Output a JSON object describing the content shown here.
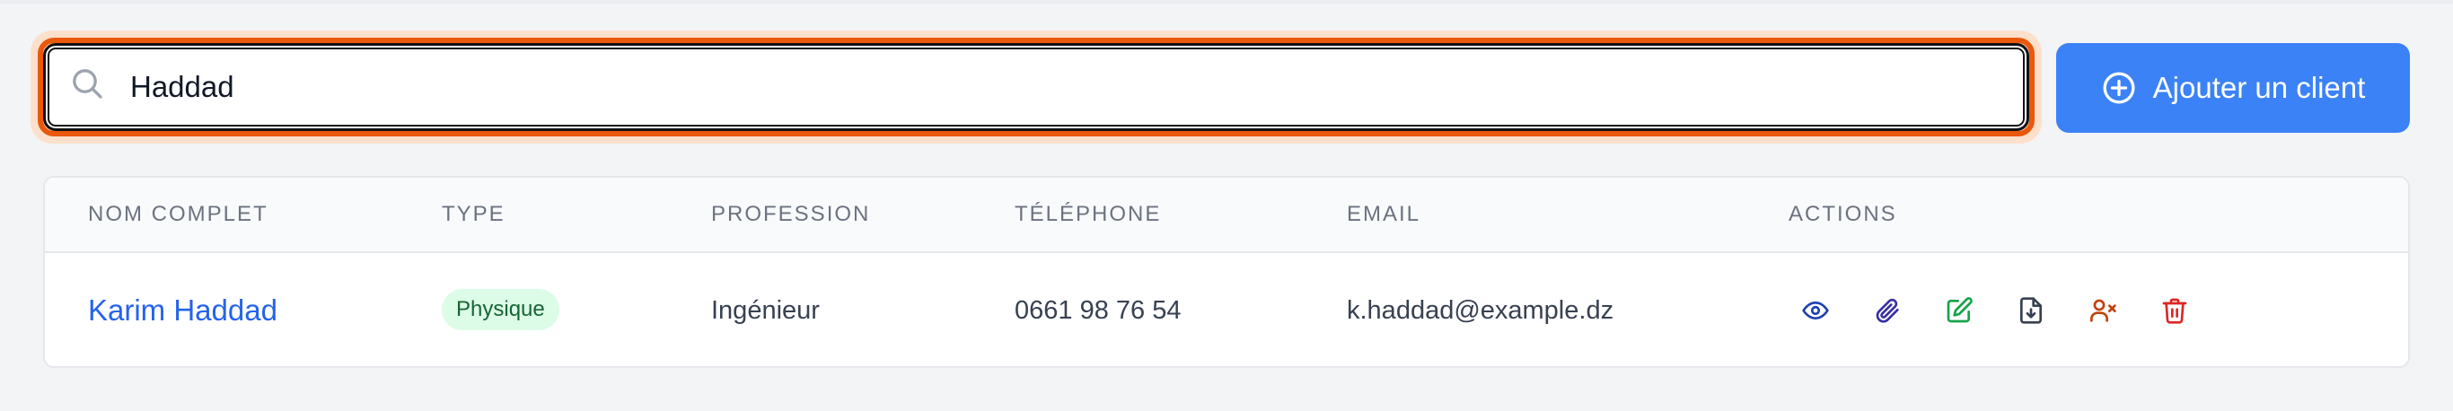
{
  "search": {
    "value": "Haddad"
  },
  "add_button": {
    "label": "Ajouter un client"
  },
  "table": {
    "headers": [
      "NOM COMPLET",
      "TYPE",
      "PROFESSION",
      "TÉLÉPHONE",
      "EMAIL",
      "ACTIONS"
    ],
    "rows": [
      {
        "name": "Karim Haddad",
        "type": "Physique",
        "profession": "Ingénieur",
        "phone": "0661 98 76 54",
        "email": "k.haddad@example.dz",
        "actions": [
          "eye-icon",
          "paperclip-icon",
          "edit-icon",
          "download-document-icon",
          "user-remove-icon",
          "trash-icon"
        ]
      }
    ]
  },
  "colors": {
    "accent": "#3b82f6",
    "focus_ring": "#ea580c",
    "link": "#2563eb",
    "badge_bg": "#dcfce7",
    "badge_text": "#166534",
    "action_view": "#1e40af",
    "action_attach": "#3730a3",
    "action_edit": "#16a34a",
    "action_download": "#374151",
    "action_deactivate": "#c2410c",
    "action_delete": "#dc2626"
  }
}
